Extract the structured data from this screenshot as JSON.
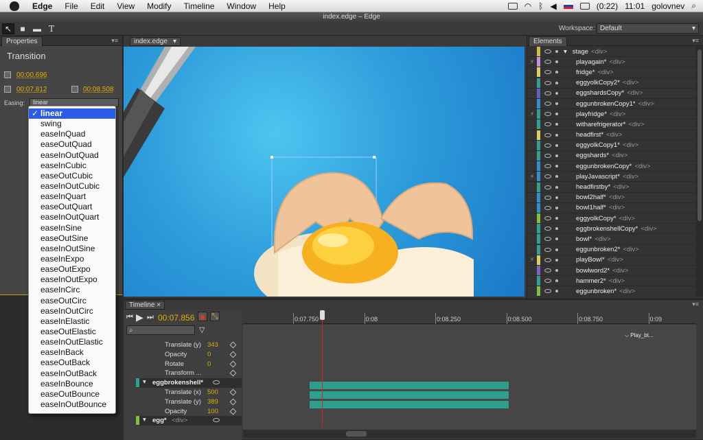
{
  "menubar": {
    "app": "Edge",
    "items": [
      "File",
      "Edit",
      "View",
      "Modify",
      "Timeline",
      "Window",
      "Help"
    ],
    "battery": "(0:22)",
    "clock": "11:01",
    "user": "golovnev"
  },
  "window": {
    "title": "index.edge – Edge"
  },
  "toolbar": {
    "workspace_label": "Workspace:",
    "workspace_value": "Default"
  },
  "properties": {
    "tab": "Properties",
    "title": "Transition",
    "duration": "00:00.696",
    "start": "00:07.812",
    "end": "00:08.508",
    "easing_label": "Easing:",
    "easing_value": "linear"
  },
  "easing_options": [
    "linear",
    "swing",
    "easeInQuad",
    "easeOutQuad",
    "easeInOutQuad",
    "easeInCubic",
    "easeOutCubic",
    "easeInOutCubic",
    "easeInQuart",
    "easeOutQuart",
    "easeInOutQuart",
    "easeInSine",
    "easeOutSine",
    "easeInOutSine",
    "easeInExpo",
    "easeOutExpo",
    "easeInOutExpo",
    "easeInCirc",
    "easeOutCirc",
    "easeInOutCirc",
    "easeInElastic",
    "easeOutElastic",
    "easeInOutElastic",
    "easeInBack",
    "easeOutBack",
    "easeInOutBack",
    "easeInBounce",
    "easeOutBounce",
    "easeInOutBounce"
  ],
  "stage_tab": "index.edge",
  "elements": {
    "tab": "Elements",
    "tag": "<div>",
    "rows": [
      {
        "name": "stage",
        "color": "#c8c040",
        "lock": "",
        "root": true
      },
      {
        "name": "playagain*",
        "color": "#c890d8",
        "lock": "⚡"
      },
      {
        "name": "fridge*",
        "color": "#d8d060",
        "lock": ""
      },
      {
        "name": "eggyolkCopy2*",
        "color": "#30a090",
        "lock": ""
      },
      {
        "name": "eggshardsCopy*",
        "color": "#6060c0",
        "lock": ""
      },
      {
        "name": "eggunbrokenCopy1*",
        "color": "#3090d0",
        "lock": ""
      },
      {
        "name": "playfridge*",
        "color": "#30a090",
        "lock": "⚡"
      },
      {
        "name": "witharefrigerator*",
        "color": "#30a090",
        "lock": ""
      },
      {
        "name": "headfirst*",
        "color": "#d8d060",
        "lock": ""
      },
      {
        "name": "eggyolkCopy1*",
        "color": "#30a090",
        "lock": ""
      },
      {
        "name": "eggshards*",
        "color": "#30a090",
        "lock": ""
      },
      {
        "name": "eggunbrokenCopy*",
        "color": "#3090d0",
        "lock": ""
      },
      {
        "name": "playJavascript*",
        "color": "#3090d0",
        "lock": "⚡"
      },
      {
        "name": "headfirstby*",
        "color": "#30a090",
        "lock": ""
      },
      {
        "name": "bowl2half*",
        "color": "#3090d0",
        "lock": ""
      },
      {
        "name": "bowl1half*",
        "color": "#3090d0",
        "lock": ""
      },
      {
        "name": "eggyolkCopy*",
        "color": "#80c040",
        "lock": ""
      },
      {
        "name": "eggbrokenshellCopy*",
        "color": "#30a090",
        "lock": ""
      },
      {
        "name": "bowl*",
        "color": "#30a090",
        "lock": ""
      },
      {
        "name": "eggunbroken2*",
        "color": "#30a090",
        "lock": ""
      },
      {
        "name": "playBowl*",
        "color": "#d8d060",
        "lock": "⚡"
      },
      {
        "name": "bowlword2*",
        "color": "#8060c0",
        "lock": ""
      },
      {
        "name": "hammer2*",
        "color": "#30a090",
        "lock": ""
      },
      {
        "name": "eggunbroken*",
        "color": "#80c040",
        "lock": ""
      }
    ]
  },
  "timeline": {
    "tab": "Timeline",
    "current_time": "00:07.856",
    "ruler": [
      "0:07.750",
      "0:08",
      "0:08.250",
      "0:08.500",
      "0:08.750",
      "0:09"
    ],
    "marker_label": "Play_bt...",
    "rows": [
      {
        "label": "Translate (y)",
        "value": "343"
      },
      {
        "label": "Opacity",
        "value": "0"
      },
      {
        "label": "Rotate",
        "value": "0"
      },
      {
        "label": "Transform ...",
        "value": ""
      },
      {
        "label": "eggbrokenshell*",
        "value": "",
        "element": true,
        "color": "#2e9e8e"
      },
      {
        "label": "Translate (x)",
        "value": "500"
      },
      {
        "label": "Translate (y)",
        "value": "389"
      },
      {
        "label": "Opacity",
        "value": "100"
      },
      {
        "label": "egg*",
        "value": "",
        "element": true,
        "color": "#80c040"
      }
    ],
    "elem_tag": "<div>"
  }
}
